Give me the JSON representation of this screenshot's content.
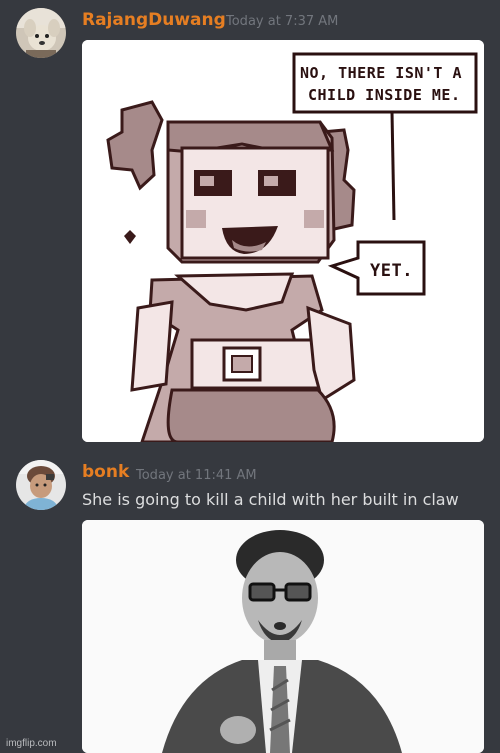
{
  "messages": [
    {
      "username": "RajangDuwang",
      "timestamp": "Today at 7:37 AM",
      "username_color": "#e67e22",
      "attachment": {
        "bubble_top": [
          "NO, THERE ISN'T A",
          "CHILD INSIDE ME."
        ],
        "bubble_bottom": "YET."
      }
    },
    {
      "username": "bonk",
      "timestamp": "Today at 11:41 AM",
      "username_color": "#e67e22",
      "text": "She is going to kill a child with her built in claw"
    }
  ],
  "watermark": "imgflip.com",
  "colors": {
    "background": "#36393f",
    "timestamp": "#72767d",
    "text": "#dcddde"
  }
}
